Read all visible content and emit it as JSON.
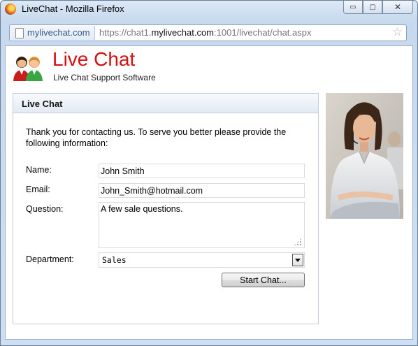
{
  "window": {
    "title": "LiveChat - Mozilla Firefox",
    "controls": {
      "minimize": "▭",
      "maximize": "▢",
      "close": "✕"
    }
  },
  "urlbar": {
    "site_label": "mylivechat.com",
    "url_prefix": "https://chat1.",
    "url_host": "mylivechat.com",
    "url_suffix": ":1001/livechat/chat.aspx",
    "star_glyph": "☆"
  },
  "brand": {
    "title": "Live Chat",
    "subtitle": "Live Chat Support Software",
    "title_color": "#d41111"
  },
  "panel": {
    "title": "Live Chat",
    "intro": "Thank you for contacting us. To serve you better please provide the following information:"
  },
  "form": {
    "name_label": "Name:",
    "name_value": "John Smith",
    "email_label": "Email:",
    "email_value": "John_Smith@hotmail.com",
    "question_label": "Question:",
    "question_value": "A few sale questions.",
    "department_label": "Department:",
    "department_value": "Sales",
    "submit_label": "Start Chat..."
  },
  "icons": {
    "browser": "firefox-icon",
    "page": "page-icon",
    "bookmark": "star-icon",
    "logo": "chat-users-icon"
  }
}
